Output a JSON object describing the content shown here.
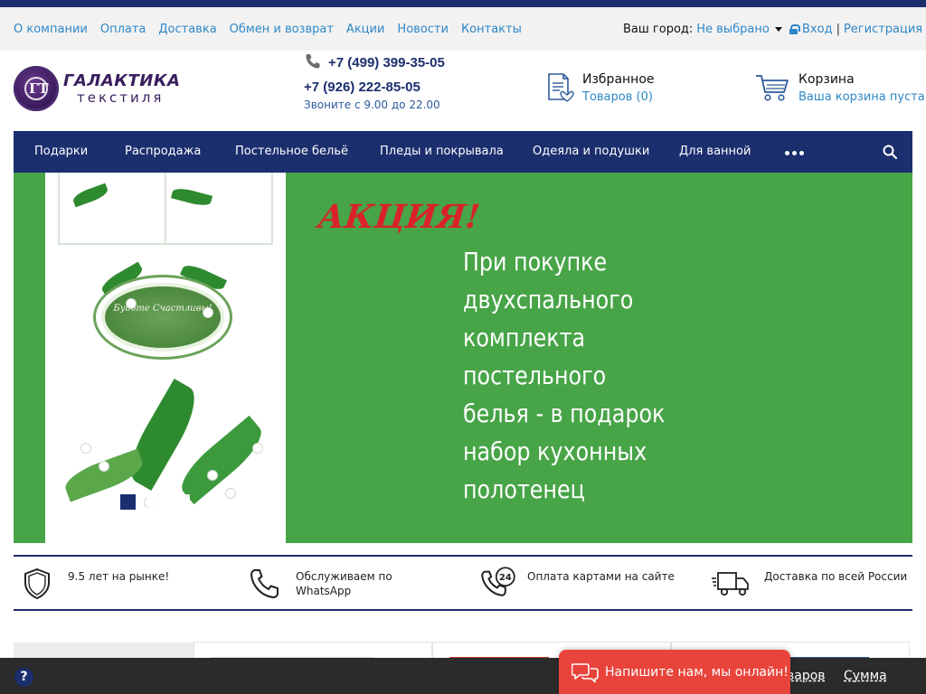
{
  "topnav": {
    "links": [
      "О компании",
      "Оплата",
      "Доставка",
      "Обмен и возврат",
      "Акции",
      "Новости",
      "Контакты"
    ],
    "city_label": "Ваш город:",
    "city_value": "Не выбрано",
    "login": "Вход",
    "separator": "|",
    "register": "Регистрация"
  },
  "logo": {
    "title": "ГАЛАКТИКА",
    "subtitle": "текстиля",
    "monogram": "ГТ"
  },
  "contacts": {
    "phone1": "+7 (499) 399-35-05",
    "phone2": "+7 (926) 222-85-05",
    "hours": "Звоните с 9.00 до 22.00"
  },
  "favorites": {
    "title": "Избранное",
    "count_text": "Товаров (0)"
  },
  "cart": {
    "title": "Корзина",
    "status": "Ваша корзина пуста"
  },
  "mainnav": {
    "items": [
      "Подарки",
      "Распродажа",
      "Постельное бельё",
      "Пледы и покрывала",
      "Одеяла и подушки",
      "Для ванной"
    ],
    "more_icon": "more-dots-icon",
    "search_icon": "search-icon"
  },
  "banner": {
    "card_text": "Будьте Счастливы!",
    "promo_title": "АКЦИЯ!",
    "promo_lines": [
      "При покупке",
      "двухспального",
      "комплекта постельного",
      "белья - в подарок",
      "набор кухонных",
      "полотенец"
    ],
    "slides_total": 3,
    "active_slide": 1
  },
  "features": [
    {
      "icon": "shield-icon",
      "text": "9.5 лет на рынке!"
    },
    {
      "icon": "phone-icon",
      "text": "Обслуживаем по WhatsApp"
    },
    {
      "icon": "phone-24-icon",
      "text": "Оплата картами на сайте"
    },
    {
      "icon": "truck-icon",
      "text": "Доставка по всей России"
    }
  ],
  "bottombar": {
    "help": "?",
    "items_label": "варов",
    "sum_label": "Сумма"
  },
  "chat": {
    "text": "Напишите нам, мы онлайн!"
  },
  "colors": {
    "brand_navy": "#1b2e6e",
    "link_blue": "#2e87c7",
    "banner_green": "#47a447",
    "promo_red": "#d9222a",
    "chat_red": "#e9443c"
  }
}
